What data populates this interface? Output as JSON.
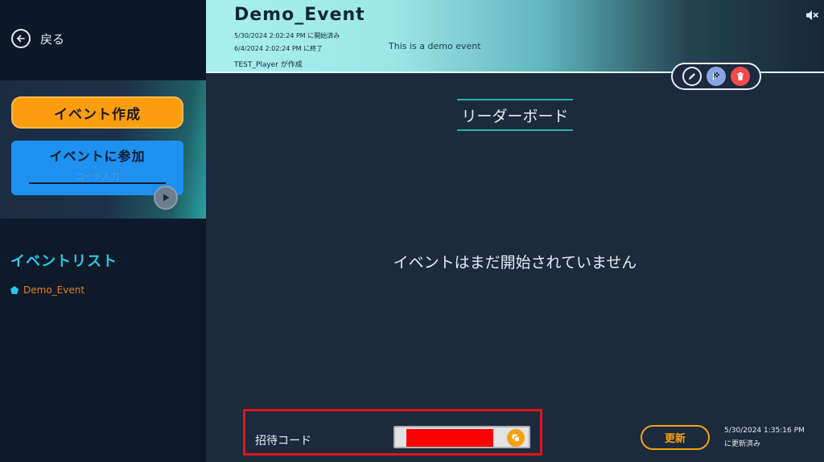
{
  "sidebar": {
    "back_label": "戻る",
    "create_label": "イベント作成",
    "join_label": "イベントに参加",
    "code_placeholder": "コード入力",
    "event_list_title": "イベントリスト",
    "events": [
      "Demo_Event"
    ]
  },
  "header": {
    "title": "Demo_Event",
    "started": "5/30/2024 2:02:24 PM に開始済み",
    "ended": "6/4/2024 2:02:24 PM に終了",
    "creator": "TEST_Player が作成",
    "description": "This is a demo event"
  },
  "main": {
    "leaderboard_title": "リーダーボード",
    "status_message": "イベントはまだ開始されていません"
  },
  "footer": {
    "invite_label": "招待コード",
    "refresh_label": "更新",
    "updated_time": "5/30/2024 1:35:16 PM",
    "updated_label": "に更新済み"
  },
  "colors": {
    "accent_orange": "#fb9d0d",
    "accent_blue": "#1e90f0",
    "accent_cyan": "#29c7e8",
    "background": "#1b2a3d",
    "highlight_red": "#e3141a"
  },
  "icons": {
    "back": "arrow-left-circle-icon",
    "play": "play-icon",
    "mute": "speaker-muted-icon",
    "edit": "pencil-icon",
    "flag": "checkered-flag-icon",
    "delete": "trash-icon",
    "copy": "copy-icon",
    "event_bullet": "pentagon-icon"
  }
}
